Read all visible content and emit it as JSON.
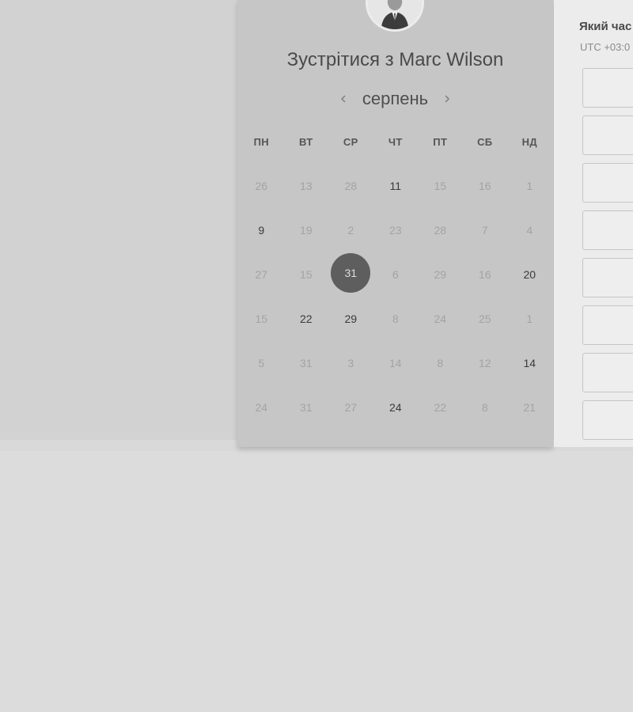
{
  "calendar": {
    "title": "Зустрітися з Marc Wilson",
    "month": "серпень",
    "prev_icon": "chevron-left-icon",
    "next_icon": "chevron-right-icon",
    "weekdays": [
      "ПН",
      "ВТ",
      "СР",
      "ЧТ",
      "ПТ",
      "СБ",
      "НД"
    ],
    "weeks": [
      [
        "26",
        "13",
        "28",
        "11",
        "15",
        "16",
        "1"
      ],
      [
        "9",
        "19",
        "2",
        "23",
        "28",
        "7",
        "4"
      ],
      [
        "27",
        "15",
        "31",
        "6",
        "29",
        "16",
        "20"
      ],
      [
        "15",
        "22",
        "29",
        "8",
        "24",
        "25",
        "1"
      ],
      [
        "5",
        "31",
        "3",
        "14",
        "8",
        "12",
        "14"
      ],
      [
        "24",
        "31",
        "27",
        "24",
        "22",
        "8",
        "21"
      ]
    ],
    "available": [
      [
        0,
        3
      ],
      [
        1,
        0
      ],
      [
        2,
        6
      ],
      [
        3,
        1
      ],
      [
        3,
        2
      ],
      [
        4,
        6
      ],
      [
        5,
        3
      ]
    ],
    "selected": [
      2,
      2
    ]
  },
  "time_panel": {
    "question": "Який час",
    "timezone": "UTC +03:0",
    "slot_count": 8
  },
  "avatar": {
    "icon": "avatar-icon"
  }
}
